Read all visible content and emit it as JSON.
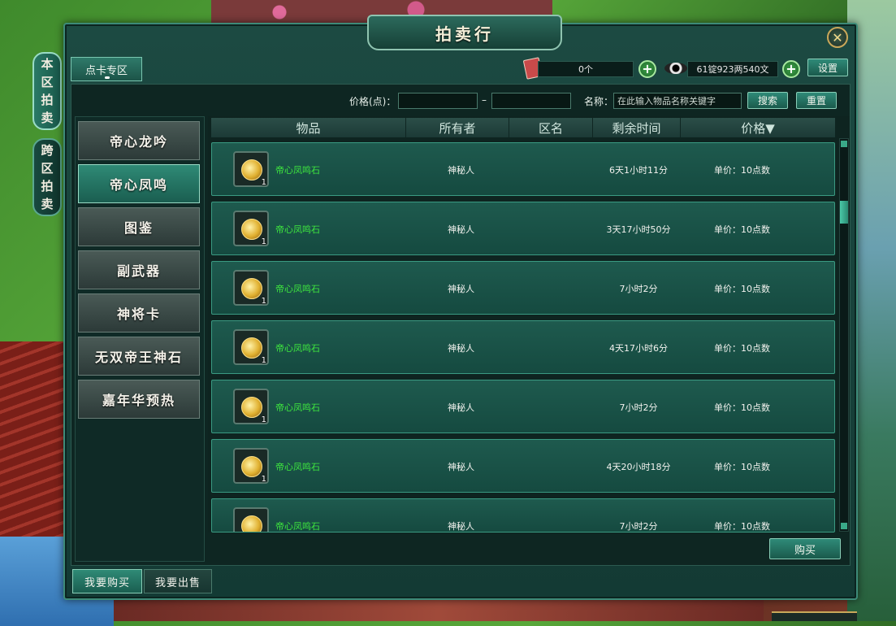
{
  "window": {
    "title": "拍卖行",
    "close_symbol": "✕"
  },
  "side_tabs": [
    {
      "label": [
        "本",
        "区",
        "拍",
        "卖"
      ],
      "active": true
    },
    {
      "label": [
        "跨",
        "区",
        "拍",
        "卖"
      ],
      "active": false
    }
  ],
  "top_tab": {
    "label": "点卡专区"
  },
  "currency": {
    "points_value": "0个",
    "money_value": "61锭923两540文",
    "plus_symbol": "+"
  },
  "settings_label": "设置",
  "search": {
    "price_label": "价格(点)：",
    "range_dash": "–",
    "name_label": "名称：",
    "name_placeholder": "在此输入物品名称关键字",
    "search_label": "搜索",
    "reset_label": "重置"
  },
  "categories": [
    "帝心龙吟",
    "帝心凤鸣",
    "图鉴",
    "副武器",
    "神将卡",
    "无双帝王神石",
    "嘉年华预热"
  ],
  "active_category": 1,
  "table": {
    "headers": [
      "物品",
      "所有者",
      "区名",
      "剩余时间",
      "价格▼"
    ],
    "rows": [
      {
        "item": "帝心凤鸣石",
        "qty": "1",
        "owner": "神秘人",
        "time": "6天1小时11分",
        "price": "单价：10点数"
      },
      {
        "item": "帝心凤鸣石",
        "qty": "1",
        "owner": "神秘人",
        "time": "3天17小时50分",
        "price": "单价：10点数"
      },
      {
        "item": "帝心凤鸣石",
        "qty": "1",
        "owner": "神秘人",
        "time": "7小时2分",
        "price": "单价：10点数"
      },
      {
        "item": "帝心凤鸣石",
        "qty": "1",
        "owner": "神秘人",
        "time": "4天17小时6分",
        "price": "单价：10点数"
      },
      {
        "item": "帝心凤鸣石",
        "qty": "1",
        "owner": "神秘人",
        "time": "7小时2分",
        "price": "单价：10点数"
      },
      {
        "item": "帝心凤鸣石",
        "qty": "1",
        "owner": "神秘人",
        "time": "4天20小时18分",
        "price": "单价：10点数"
      },
      {
        "item": "帝心凤鸣石",
        "qty": "1",
        "owner": "神秘人",
        "time": "7小时2分",
        "price": "单价：10点数"
      }
    ]
  },
  "buy_button": "购买",
  "bottom_tabs": [
    {
      "label": "我要购买",
      "active": true
    },
    {
      "label": "我要出售",
      "active": false
    }
  ],
  "colors": {
    "accent": "#2f8a78",
    "item_name": "#3ee83e",
    "gold": "#c9a85a"
  }
}
